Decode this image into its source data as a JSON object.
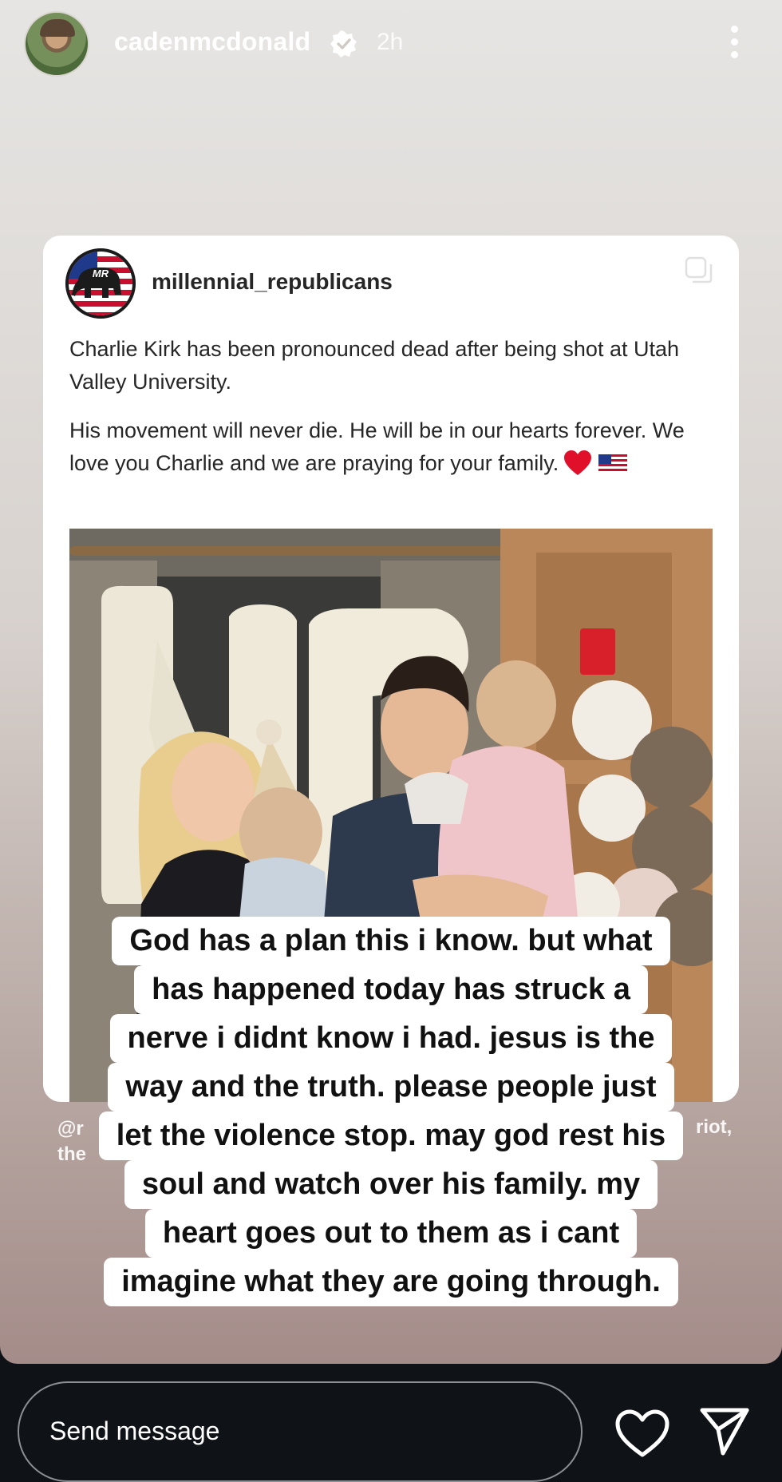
{
  "header": {
    "username": "cadenmcdonald",
    "time": "2h"
  },
  "post": {
    "username": "millennial_republicans",
    "paragraph1": "Charlie Kirk has been pronounced dead after being shot at Utah Valley University.",
    "paragraph2": "His movement will never die. He will be in our hearts forever. We love you Charlie and we are praying for your family.",
    "avatar_text": "MR"
  },
  "caption_fragments": {
    "left_line1": "@r",
    "left_line2": "the",
    "right": "riot,"
  },
  "overlay_lines": [
    "God has a plan this i know. but what",
    "has happened today has struck a",
    "nerve i didnt know i had. jesus is the",
    "way and the truth. please people just",
    "let the violence stop. may god rest his",
    "soul and watch over his family. my",
    "heart goes out to them as i cant",
    "imagine what they are going through."
  ],
  "footer": {
    "message_placeholder": "Send message"
  },
  "icons": {
    "verified": "verified-badge-icon",
    "more": "more-options-icon",
    "copy": "copy-icon",
    "like": "heart-outline-icon",
    "share": "paper-plane-icon"
  }
}
